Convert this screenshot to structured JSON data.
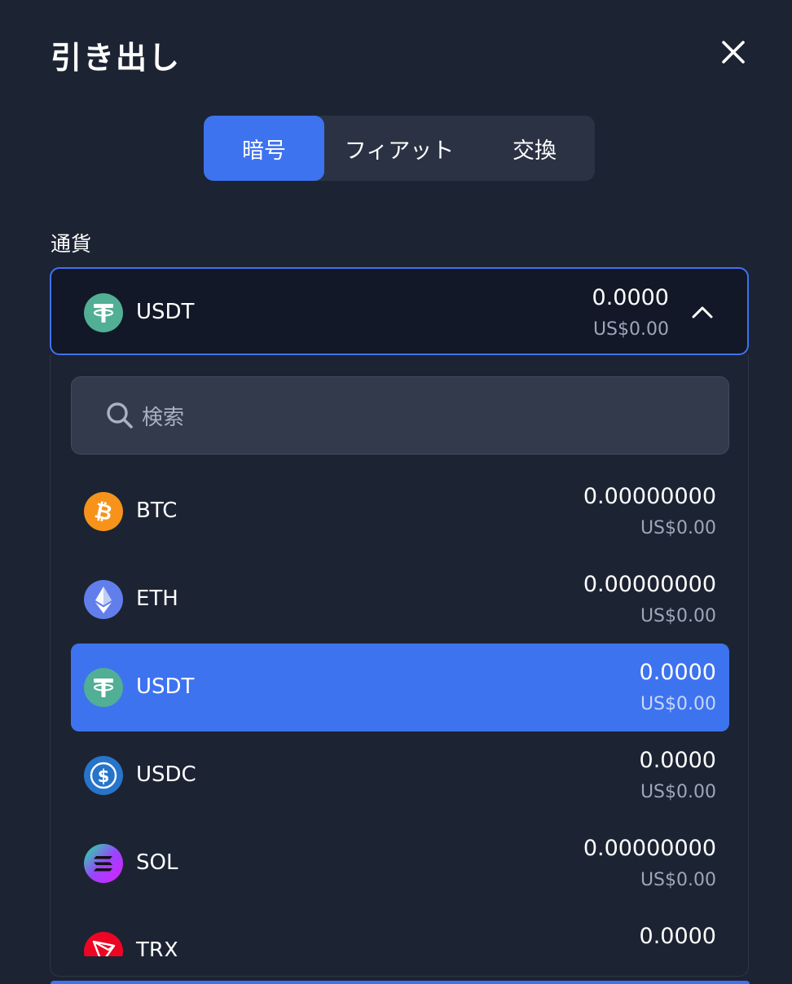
{
  "header": {
    "title": "引き出し"
  },
  "tabs": [
    {
      "label": "暗号",
      "active": true
    },
    {
      "label": "フィアット",
      "active": false
    },
    {
      "label": "交換",
      "active": false
    }
  ],
  "currency": {
    "label": "通貨",
    "selected": {
      "name": "USDT",
      "amount": "0.0000",
      "usd": "US$0.00",
      "icon": "tether-icon"
    }
  },
  "search": {
    "placeholder": "検索"
  },
  "coins": [
    {
      "name": "BTC",
      "amount": "0.00000000",
      "usd": "US$0.00",
      "icon": "bitcoin-icon",
      "color": "#f7931a"
    },
    {
      "name": "ETH",
      "amount": "0.00000000",
      "usd": "US$0.00",
      "icon": "ethereum-icon",
      "color": "#627eea"
    },
    {
      "name": "USDT",
      "amount": "0.0000",
      "usd": "US$0.00",
      "icon": "tether-icon",
      "color": "#50af95",
      "selected": true
    },
    {
      "name": "USDC",
      "amount": "0.0000",
      "usd": "US$0.00",
      "icon": "usdc-icon",
      "color": "#2775ca"
    },
    {
      "name": "SOL",
      "amount": "0.00000000",
      "usd": "US$0.00",
      "icon": "solana-icon",
      "color": "#9945ff"
    },
    {
      "name": "TRX",
      "amount": "0.0000",
      "icon": "tron-icon",
      "color": "#ec0623"
    }
  ],
  "colors": {
    "background": "#1c2333",
    "accent": "#3e73ef",
    "field": "#121827"
  }
}
